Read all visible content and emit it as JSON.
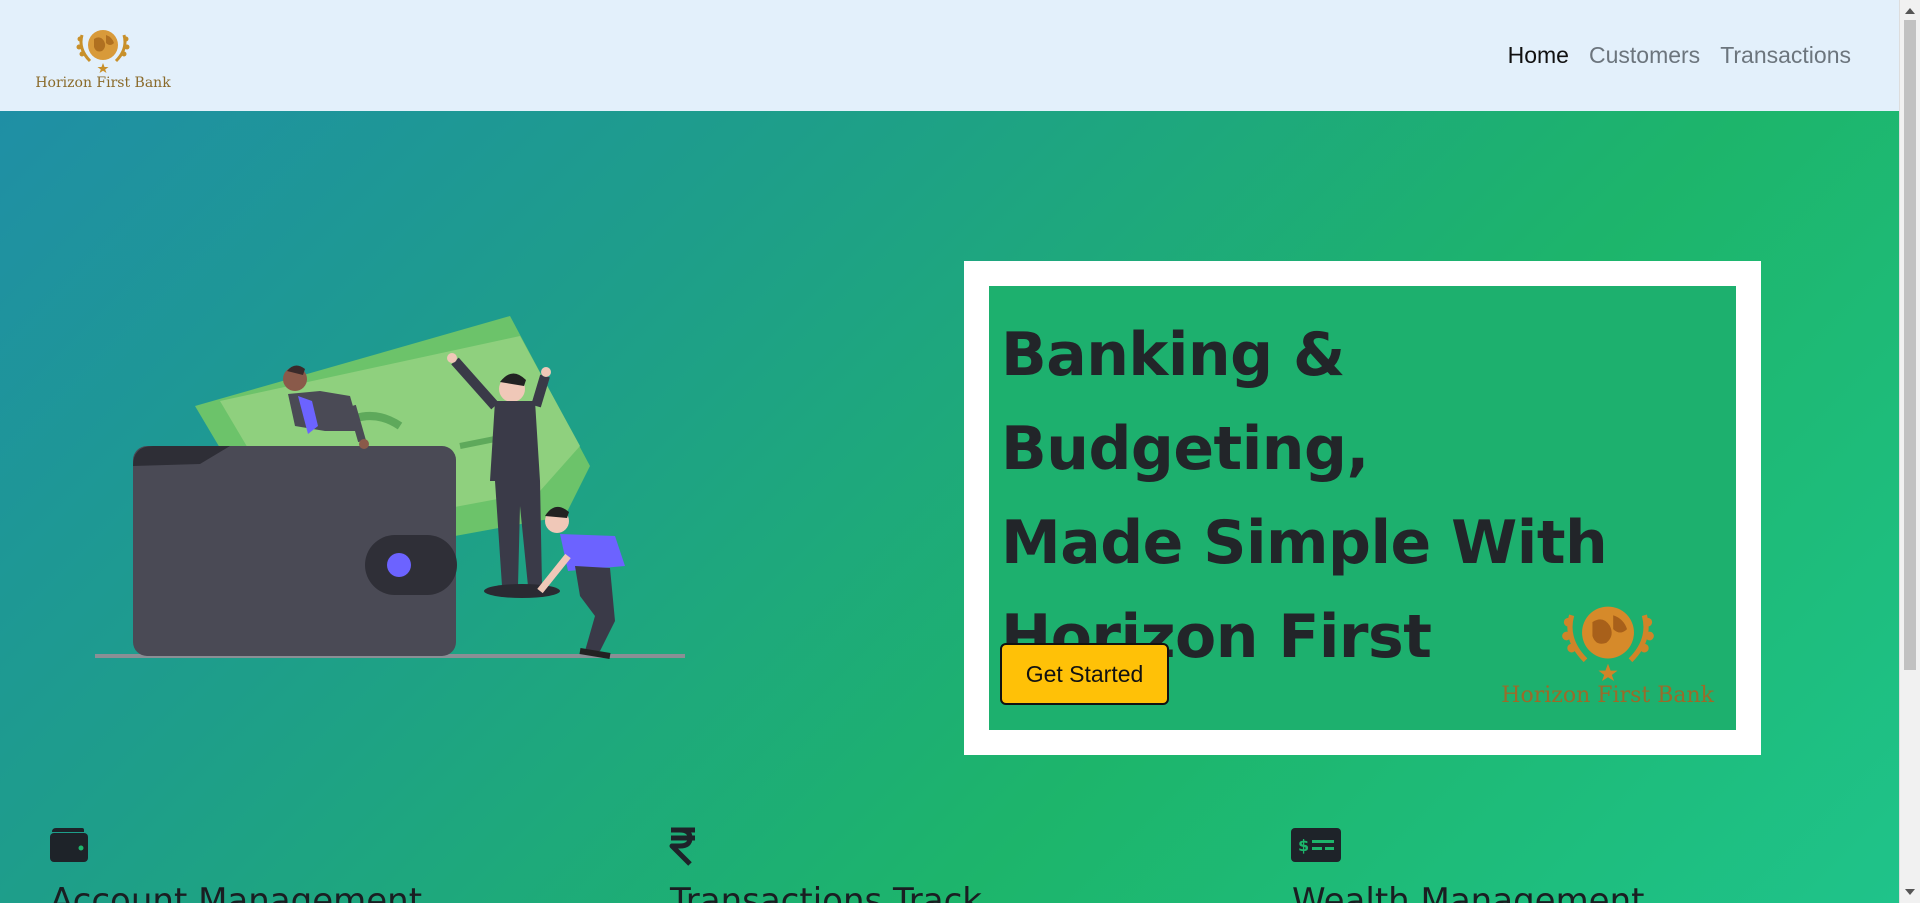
{
  "brand": {
    "name": "Horizon First Bank"
  },
  "nav": {
    "links": [
      {
        "label": "Home",
        "active": true
      },
      {
        "label": "Customers",
        "active": false
      },
      {
        "label": "Transactions",
        "active": false
      }
    ]
  },
  "hero": {
    "headline_line1": "Banking & Budgeting,",
    "headline_line2": "Made Simple With",
    "headline_line3": "Horizon First",
    "cta_label": "Get Started",
    "card_logo_text": "Horizon First Bank"
  },
  "features": [
    {
      "title": "Account Management",
      "icon": "wallet-icon"
    },
    {
      "title": "Transactions Track",
      "icon": "rupee-icon"
    },
    {
      "title": "Wealth Management",
      "icon": "money-check-icon"
    }
  ],
  "colors": {
    "nav_bg": "#e3f0fb",
    "cta": "#ffc107",
    "gold": "#c8902a"
  }
}
